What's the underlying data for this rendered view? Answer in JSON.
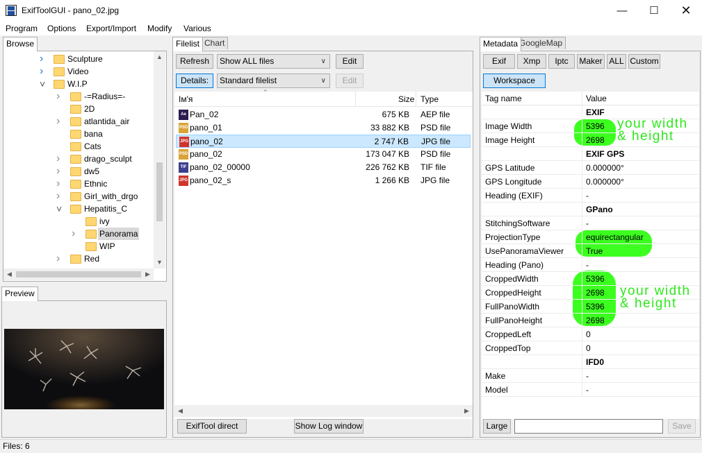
{
  "window": {
    "title": "ExifToolGUI - pano_02.jpg",
    "icon_name": "exiftoolgui-app-icon",
    "icon_text": "Exif\nGUI"
  },
  "menu": [
    "Program",
    "Options",
    "Export/Import",
    "Modify",
    "Various"
  ],
  "left": {
    "browse_tab": "Browse",
    "tree": [
      {
        "label": "Sculpture",
        "level": 1,
        "expand": "collapsed"
      },
      {
        "label": "Video",
        "level": 1,
        "expand": "collapsed"
      },
      {
        "label": "W.I.P",
        "level": 1,
        "expand": "expanded"
      },
      {
        "label": "-=Radius=-",
        "level": 2,
        "expand": "collapsed"
      },
      {
        "label": "2D",
        "level": 2,
        "expand": "none"
      },
      {
        "label": "atlantida_air",
        "level": 2,
        "expand": "collapsed"
      },
      {
        "label": "bana",
        "level": 2,
        "expand": "none"
      },
      {
        "label": "Cats",
        "level": 2,
        "expand": "none"
      },
      {
        "label": "drago_sculpt",
        "level": 2,
        "expand": "collapsed"
      },
      {
        "label": "dw5",
        "level": 2,
        "expand": "collapsed"
      },
      {
        "label": "Ethnic",
        "level": 2,
        "expand": "collapsed"
      },
      {
        "label": "Girl_with_drgo",
        "level": 2,
        "expand": "collapsed"
      },
      {
        "label": "Hepatitis_C",
        "level": 2,
        "expand": "expanded"
      },
      {
        "label": "ivy",
        "level": 3,
        "expand": "none"
      },
      {
        "label": "Panorama",
        "level": 3,
        "expand": "collapsed",
        "selected": true
      },
      {
        "label": "WIP",
        "level": 3,
        "expand": "none"
      },
      {
        "label": "Red",
        "level": 2,
        "expand": "collapsed"
      }
    ],
    "preview_tab": "Preview"
  },
  "center": {
    "tabs": [
      "Filelist",
      "Chart"
    ],
    "refresh_label": "Refresh",
    "filter_value": "Show ALL files",
    "edit_label": "Edit",
    "details_label": "Details:",
    "details_value": "Standard filelist",
    "edit2_label": "Edit",
    "columns": {
      "name": "Ім'я",
      "size": "Size",
      "type": "Type"
    },
    "files": [
      {
        "name": "Pan_02",
        "size": "675 KB",
        "type": "AEP file",
        "icon": "aep-file-icon",
        "icon_text": "Ae",
        "color": "#2b1d4f"
      },
      {
        "name": "pano_01",
        "size": "33 882 KB",
        "type": "PSD file",
        "icon": "psd-file-icon",
        "icon_text": "PSD",
        "color": "#d9a33a"
      },
      {
        "name": "pano_02",
        "size": "2 747 KB",
        "type": "JPG file",
        "icon": "jpg-file-icon",
        "icon_text": "JPG",
        "color": "#d0342c",
        "selected": true
      },
      {
        "name": "pano_02",
        "size": "173 047 KB",
        "type": "PSD file",
        "icon": "psd-file-icon",
        "icon_text": "PSD",
        "color": "#d9a33a"
      },
      {
        "name": "pano_02_00000",
        "size": "226 762 KB",
        "type": "TIF file",
        "icon": "tif-file-icon",
        "icon_text": "TIF",
        "color": "#3a3f8f"
      },
      {
        "name": "pano_02_s",
        "size": "1 266 KB",
        "type": "JPG file",
        "icon": "jpg-file-icon",
        "icon_text": "JPG",
        "color": "#d0342c"
      }
    ],
    "exiftool_direct_label": "ExifTool direct",
    "show_log_label": "Show Log window"
  },
  "right": {
    "tabs": [
      "Metadata",
      "GoogleMap"
    ],
    "buttons": [
      "Exif",
      "Xmp",
      "Iptc",
      "Maker",
      "ALL",
      "Custom"
    ],
    "workspace_label": "Workspace",
    "columns": {
      "tag": "Tag name",
      "value": "Value"
    },
    "rows": [
      {
        "group": "EXIF"
      },
      {
        "tag": "Image Width",
        "value": "5396"
      },
      {
        "tag": "Image Height",
        "value": "2698"
      },
      {
        "group": "EXIF GPS"
      },
      {
        "tag": "GPS Latitude",
        "value": "0.000000°"
      },
      {
        "tag": "GPS Longitude",
        "value": "0.000000°"
      },
      {
        "tag": "Heading (EXIF)",
        "value": "-"
      },
      {
        "group": "GPano"
      },
      {
        "tag": "StitchingSoftware",
        "value": "-"
      },
      {
        "tag": "ProjectionType",
        "value": "equirectangular"
      },
      {
        "tag": "UsePanoramaViewer",
        "value": "True"
      },
      {
        "tag": "Heading (Pano)",
        "value": "-"
      },
      {
        "tag": "CroppedWidth",
        "value": "5396"
      },
      {
        "tag": "CroppedHeight",
        "value": "2698"
      },
      {
        "tag": "FullPanoWidth",
        "value": "5396"
      },
      {
        "tag": "FullPanoHeight",
        "value": "2698"
      },
      {
        "tag": "CroppedLeft",
        "value": "0"
      },
      {
        "tag": "CroppedTop",
        "value": "0"
      },
      {
        "group": "IFD0"
      },
      {
        "tag": "Make",
        "value": "-"
      },
      {
        "tag": "Model",
        "value": "-"
      }
    ],
    "annotation_1": "your width\n& height",
    "annotation_2": "your width\n& height",
    "highlight_color": "#3cff20",
    "large_label": "Large",
    "edit_value": "",
    "save_label": "Save"
  },
  "status": {
    "files": "Files: 6"
  }
}
